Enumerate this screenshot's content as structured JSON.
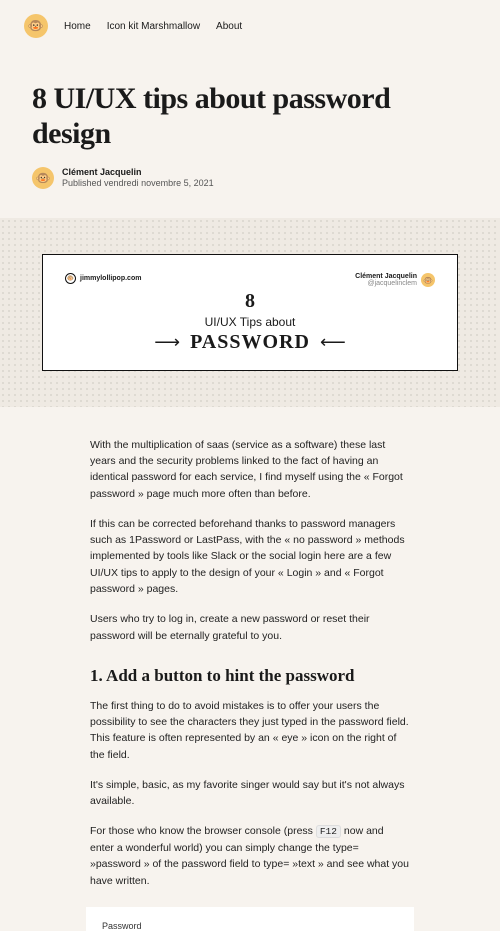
{
  "nav": {
    "links": [
      "Home",
      "Icon kit Marshmallow",
      "About"
    ]
  },
  "article": {
    "title": "8 UI/UX tips about password design",
    "author": {
      "name": "Clément Jacquelin",
      "date_prefix": "Published",
      "date": "vendredi novembre 5, 2021"
    }
  },
  "hero": {
    "site": "jimmylollipop.com",
    "credit_name": "Clément Jacquelin",
    "credit_handle": "@jacquelinclem",
    "number": "8",
    "subtitle": "UI/UX Tips about",
    "keyword": "PASSWORD"
  },
  "body": {
    "p1": "With the multiplication of saas (service as a software) these last years and the security problems linked to the fact of having an identical password for each service, I find myself using the « Forgot password » page much more often than before.",
    "p2": "If this can be corrected beforehand thanks to password managers such as 1Password or LastPass, with the « no password » methods implemented by tools like Slack or the social login here are a few UI/UX tips to apply to the design of your « Login » and « Forgot password » pages.",
    "p3": "Users who try to log in, create a new password or reset their password will be eternally grateful to you.",
    "h2_1": "1. Add a button to hint the password",
    "p4": "The first thing to do to avoid mistakes is to offer your users the possibility to see the characters they just typed in the password field. This feature is often represented by an « eye » icon on the right of the field.",
    "p5": "It's simple, basic, as my favorite singer would say but it's not always available.",
    "p6_a": "For those who know the browser console (press ",
    "p6_kbd": "F12",
    "p6_b": " now and enter a wonderful world) you can simply change the type= »password » of the password field to type= »text » and see what you have written.",
    "pw_label": "Password"
  }
}
